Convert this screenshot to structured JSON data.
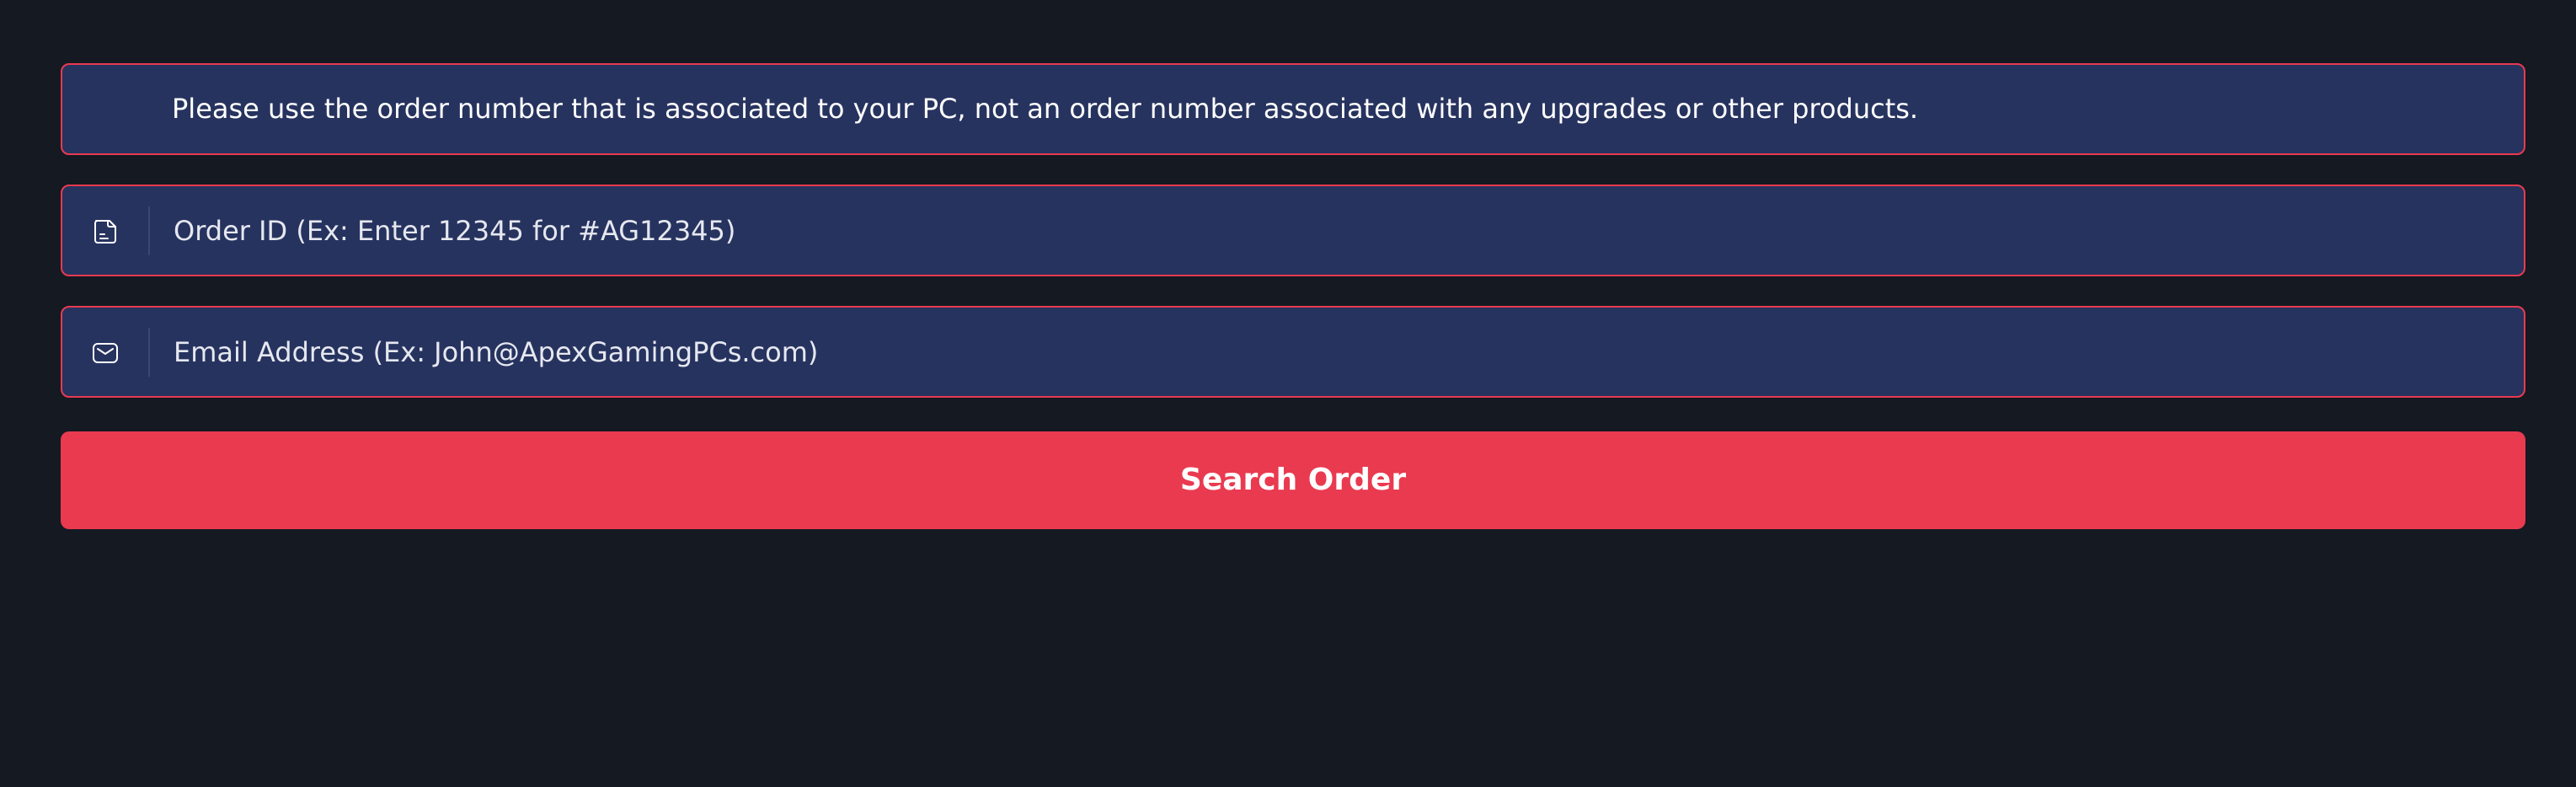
{
  "notice": {
    "text": "Please use the order number that is associated to your PC, not an order number associated with any upgrades or other products."
  },
  "order_field": {
    "icon": "document-icon",
    "value": "",
    "placeholder": "Order ID (Ex: Enter 12345 for #AG12345)"
  },
  "email_field": {
    "icon": "mail-icon",
    "value": "",
    "placeholder": "Email Address (Ex: John@ApexGamingPCs.com)"
  },
  "search_button": {
    "label": "Search Order"
  },
  "colors": {
    "background": "#141922",
    "panel": "#27335f",
    "accent": "#e93a50"
  }
}
